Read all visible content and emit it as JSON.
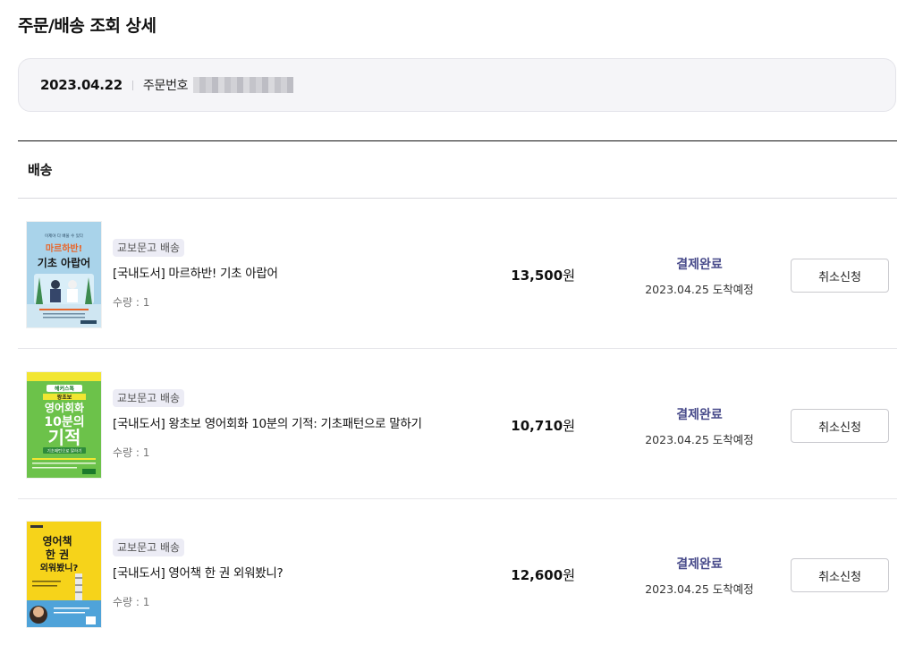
{
  "page": {
    "title": "주문/배송 조회 상세"
  },
  "order": {
    "date": "2023.04.22",
    "number_label": "주문번호"
  },
  "section": {
    "label": "배송"
  },
  "items": [
    {
      "badge": "교보문고 배송",
      "title": "[국내도서] 마르하반! 기초 아랍어",
      "qty": "수량 : 1",
      "price": "13,500",
      "currency": "원",
      "status": "결제완료",
      "arrival": "2023.04.25 도착예정",
      "button": "취소신청",
      "cover": {
        "top": "이제야 다 배울 수 있다",
        "line1": "마르하반!",
        "line2": "기초 아랍어"
      }
    },
    {
      "badge": "교보문고 배송",
      "title": "[국내도서] 왕초보 영어회화 10분의 기적: 기초패턴으로 말하기",
      "qty": "수량 : 1",
      "price": "10,710",
      "currency": "원",
      "status": "결제완료",
      "arrival": "2023.04.25 도착예정",
      "button": "취소신청",
      "cover": {
        "top": "해커스톡",
        "line0": "왕초보",
        "line1": "영어회화",
        "line2": "10분의",
        "line3": "기적",
        "line4": "기초패턴으로 말하기"
      }
    },
    {
      "badge": "교보문고 배송",
      "title": "[국내도서] 영어책 한 권 외워봤니?",
      "qty": "수량 : 1",
      "price": "12,600",
      "currency": "원",
      "status": "결제완료",
      "arrival": "2023.04.25 도착예정",
      "button": "취소신청",
      "cover": {
        "line1": "영어책",
        "line2": "한 권",
        "line3": "외워봤니?"
      }
    }
  ],
  "colors": {
    "status": "#474a8a",
    "badge_bg": "#ececf5",
    "cover1_bg": "#a9d3ea",
    "cover2_bg": "#6cc24a",
    "cover3_bg": "#f6d31a"
  }
}
